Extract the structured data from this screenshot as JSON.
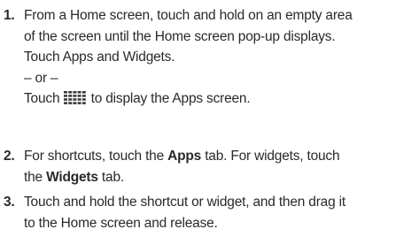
{
  "steps": [
    {
      "number": "1.",
      "lines": [
        "From a Home screen, touch and hold on an empty area",
        "of the screen until the Home screen pop-up displays.",
        "Touch Apps and Widgets."
      ],
      "or": "– or –",
      "alt_before_icon": "Touch",
      "alt_icon": "apps-grid-icon",
      "alt_after_icon": "to display the Apps screen."
    },
    {
      "number": "2.",
      "line1_a": "For shortcuts, touch the ",
      "line1_b": "Apps",
      "line1_c": " tab. For widgets, touch",
      "line2_a": "the ",
      "line2_b": "Widgets",
      "line2_c": " tab."
    },
    {
      "number": "3.",
      "lines": [
        "Touch and hold the shortcut or widget, and then drag it",
        "to the Home screen and release."
      ]
    }
  ],
  "colors": {
    "text": "#2a2a2a",
    "icon": "#3a3a3a"
  }
}
